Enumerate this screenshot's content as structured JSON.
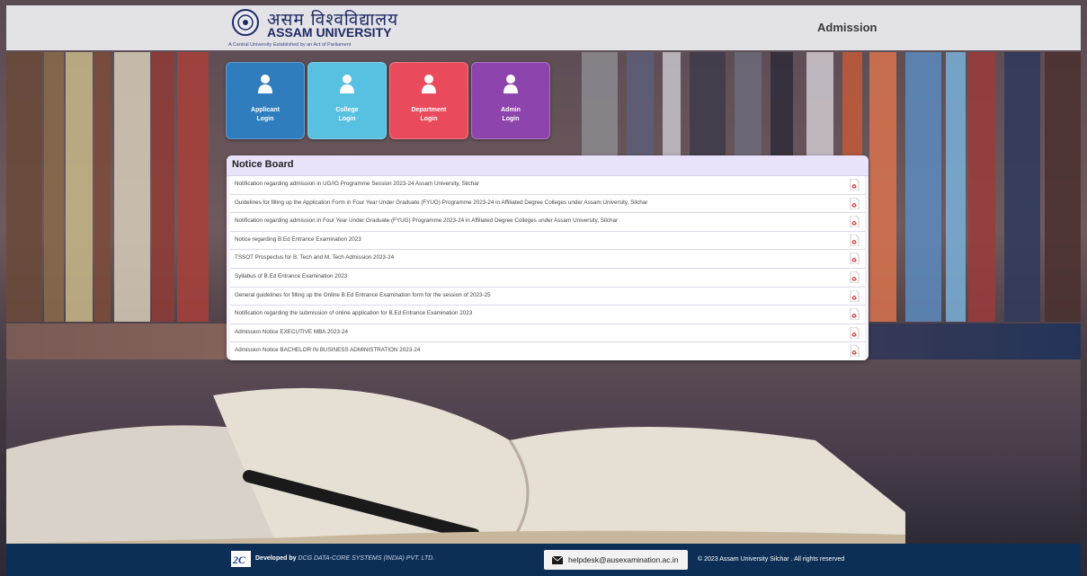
{
  "header": {
    "logo_hindi": "असम विश्वविद्यालय",
    "logo_english": "ASSAM UNIVERSITY",
    "logo_tagline": "A Central University Established by an Act of Parliament",
    "page_title": "Admission"
  },
  "login_tiles": [
    {
      "label": "Applicant\nLogin",
      "color": "#2f7dbd",
      "icon": "user-icon"
    },
    {
      "label": "College\nLogin",
      "color": "#58c0e0",
      "icon": "user-icon"
    },
    {
      "label": "Department\nLogin",
      "color": "#ea4b5c",
      "icon": "user-icon"
    },
    {
      "label": "Admin\nLogin",
      "color": "#8e44ad",
      "icon": "user-icon"
    }
  ],
  "notice_board": {
    "title": "Notice Board",
    "items": [
      "Notification regarding admission in UG/IG Programme Session 2023-24 Assam University, Silchar",
      "Guidelines for filling up the Application Form in Four Year Under Graduate (FYUG) Programme 2023-24 in Affiliated Degree Colleges under Assam University, Silchar",
      "Notification regarding admission in Four Year Under Graduate (FYUG) Programme 2023-24 in Affiliated Degree Colleges under Assam University, Silchar",
      "Notice regarding B.Ed Entrance Examination 2023",
      "TSSOT Prospectus for B. Tech and M. Tech Admission 2023-24",
      "Syllabus of B.Ed Entrance Examination 2023",
      "General guidelines for filling up the Online B.Ed Entrance Examination form for the session of 2023-25",
      "Notification regarding the submission of online application for B.Ed Entrance Examination 2023",
      "Admission Notice EXECUTIVE MBA 2023-24",
      "Admission Notice BACHELOR IN BUSINESS ADMINISTRATION 2023-24"
    ],
    "item_icon": "pdf-icon"
  },
  "footer": {
    "developed_by": "Developed by",
    "company": "DCG DATA-CORE SYSTEMS (INDIA) PVT. LTD.",
    "helpdesk_email": "helpdesk@ausexamination.ac.in",
    "copyright": "© 2023 Assam University Silchar . All rights reserved",
    "colors": {
      "footer_bg": "#0d2f56"
    }
  }
}
